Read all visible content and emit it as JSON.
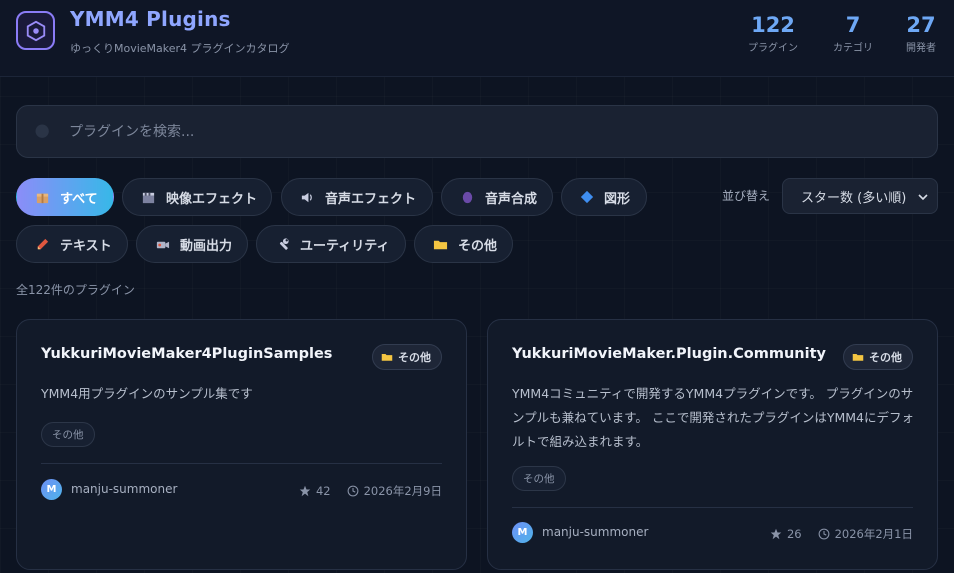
{
  "header": {
    "title": "YMM4 Plugins",
    "subtitle": "ゆっくりMovieMaker4 プラグインカタログ",
    "stats": [
      {
        "value": "122",
        "label": "プラグイン"
      },
      {
        "value": "7",
        "label": "カテゴリ"
      },
      {
        "value": "27",
        "label": "開発者"
      }
    ]
  },
  "search": {
    "placeholder": "プラグインを検索...",
    "value": ""
  },
  "filters": [
    {
      "label": "すべて",
      "icon": "package-icon",
      "active": true
    },
    {
      "label": "映像エフェクト",
      "icon": "clapperboard-icon",
      "active": false
    },
    {
      "label": "音声エフェクト",
      "icon": "speaker-icon",
      "active": false
    },
    {
      "label": "音声合成",
      "icon": "speaking-head-icon",
      "active": false
    },
    {
      "label": "図形",
      "icon": "diamond-icon",
      "active": false
    },
    {
      "label": "テキスト",
      "icon": "pencil-icon",
      "active": false
    },
    {
      "label": "動画出力",
      "icon": "video-camera-icon",
      "active": false
    },
    {
      "label": "ユーティリティ",
      "icon": "wrench-icon",
      "active": false
    },
    {
      "label": "その他",
      "icon": "folder-icon",
      "active": false
    }
  ],
  "sort": {
    "label": "並び替え",
    "selected": "スター数 (多い順)"
  },
  "result_count": "全122件のプラグイン",
  "plugins": [
    {
      "name": "YukkuriMovieMaker4PluginSamples",
      "category": "その他",
      "description": "YMM4用プラグインのサンプル集です",
      "tag": "その他",
      "author": "manju-summoner",
      "author_initial": "M",
      "stars": "42",
      "date": "2026年2月9日"
    },
    {
      "name": "YukkuriMovieMaker.Plugin.Community",
      "category": "その他",
      "description": "YMM4コミュニティで開発するYMM4プラグインです。 プラグインのサンプルも兼ねています。 ここで開発されたプラグインはYMM4にデフォルトで組み込まれます。",
      "tag": "その他",
      "author": "manju-summoner",
      "author_initial": "M",
      "stars": "26",
      "date": "2026年2月1日"
    }
  ],
  "colors": {
    "accent": "#8fa6ff",
    "stat": "#6ea8f5",
    "bg": "#0d1422"
  }
}
